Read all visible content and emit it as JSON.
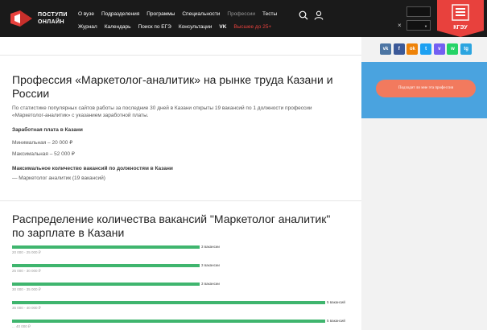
{
  "header": {
    "logo": {
      "line1": "ПОСТУПИ",
      "line2": "ОНЛАЙН"
    },
    "nav_row1": [
      {
        "label": "О вузе",
        "style": "normal"
      },
      {
        "label": "Подразделения",
        "style": "normal"
      },
      {
        "label": "Программы",
        "style": "normal"
      },
      {
        "label": "Специальности",
        "style": "normal"
      },
      {
        "label": "Профессии",
        "style": "muted"
      },
      {
        "label": "Тесты",
        "style": "normal"
      }
    ],
    "nav_row2": [
      {
        "label": "Журнал",
        "style": "normal"
      },
      {
        "label": "Календарь",
        "style": "normal"
      },
      {
        "label": "Поиск по ЕГЭ",
        "style": "normal"
      },
      {
        "label": "Консультации",
        "style": "normal"
      },
      {
        "label": "VK",
        "style": "vk"
      },
      {
        "label": "Высшее до 25+",
        "style": "accent"
      }
    ],
    "icons": {
      "search": "search-icon",
      "user": "user-icon"
    },
    "close_glyph": "×",
    "badge_text": "КГЭУ"
  },
  "profession_section": {
    "title": "Профессия «Маркетолог-аналитик» на рынке труда Казани и России",
    "intro": "По статистике популярных сайтов работы за последние 30 дней в Казани открыты 19 вакансий по 1 должности профессии «Маркетолог-аналитик» с указанием заработной платы.",
    "salary_heading": "Заработная плата в Казани",
    "salary_min": "Минимальная – 20 000 ₽",
    "salary_max": "Максимальная – 52 000 ₽",
    "positions_heading": "Максимальное количество вакансий по должностям в Казани",
    "positions_item": "— Маркетолог аналитик (19 вакансий)"
  },
  "distribution_section": {
    "title": "Распределение количества вакансий \"Маркетолог аналитик\" по зарплате в Казани"
  },
  "chart_data": {
    "type": "bar",
    "orientation": "horizontal",
    "categories": [
      "20 000 - 25 000 ₽",
      "25 000 - 30 000 ₽",
      "30 000 - 35 000 ₽",
      "35 000 - 40 000 ₽",
      "... 40 000 ₽"
    ],
    "values": [
      3,
      3,
      3,
      5,
      5
    ],
    "value_labels": [
      "3 вакансии",
      "3 вакансии",
      "3 вакансии",
      "5 вакансий",
      "5 вакансий"
    ],
    "xlim": [
      0,
      5
    ],
    "color": "#3fb56e"
  },
  "sidebar": {
    "share_buttons": [
      {
        "label": "vk",
        "name": "share-vk-button",
        "color": "#4c75a3"
      },
      {
        "label": "f",
        "name": "share-facebook-button",
        "color": "#3b5998"
      },
      {
        "label": "ok",
        "name": "share-ok-button",
        "color": "#ee8208"
      },
      {
        "label": "t",
        "name": "share-twitter-button",
        "color": "#1da1f2"
      },
      {
        "label": "v",
        "name": "share-viber-button",
        "color": "#7360f2"
      },
      {
        "label": "w",
        "name": "share-whatsapp-button",
        "color": "#25d366"
      },
      {
        "label": "tg",
        "name": "share-telegram-button",
        "color": "#2ca5e0"
      }
    ],
    "cta_label": "Подходит ли мне эта профессия"
  },
  "colors": {
    "header_bg": "#1a1a1a",
    "accent_red": "#e8413d",
    "cta_panel": "#4aa3df",
    "cta_button": "#f27a5e"
  }
}
